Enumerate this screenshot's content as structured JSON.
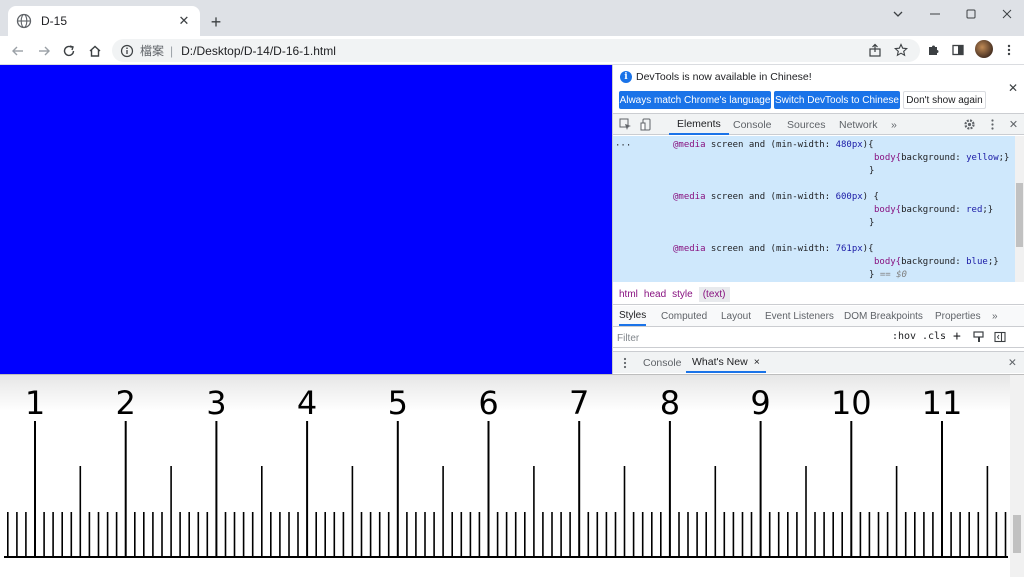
{
  "browser": {
    "tab_title": "D-15",
    "security_label": "檔案",
    "separator": "|",
    "url": "D:/Desktop/D-14/D-16-1.html",
    "page_background": "#0000ff"
  },
  "devtools": {
    "banner_message": "DevTools is now available in Chinese!",
    "banner_buttons": [
      "Always match Chrome's language",
      "Switch DevTools to Chinese",
      "Don't show again"
    ],
    "main_tabs": [
      "Elements",
      "Console",
      "Sources",
      "Network"
    ],
    "active_main_tab": "Elements",
    "code": {
      "m1_at": "@media",
      "m1_rest": " screen and (min-width: ",
      "m1_val": "480px",
      "m1_end": "){",
      "m1_body_sel": "body{",
      "m1_prop": "background",
      "m1_colon": ": ",
      "m1_color": "yellow",
      "m1_close": ";}",
      "m1_brace": "}",
      "m2_at": "@media",
      "m2_rest": " screen and (min-width: ",
      "m2_val": "600px",
      "m2_end": ") {",
      "m2_body_sel": "body{",
      "m2_prop": "background",
      "m2_colon": ": ",
      "m2_color": "red",
      "m2_close": ";}",
      "m2_brace": "}",
      "m3_at": "@media",
      "m3_rest": " screen and (min-width: ",
      "m3_val": "761px",
      "m3_end": "){",
      "m3_body_sel": "body{",
      "m3_prop": "background",
      "m3_colon": ": ",
      "m3_color": "blue",
      "m3_close": ";}",
      "m3_brace": "}",
      "m3_eq": " == $0",
      "gutter": "···"
    },
    "breadcrumbs": [
      "html",
      "head",
      "style",
      "(text)"
    ],
    "sub_tabs": [
      "Styles",
      "Computed",
      "Layout",
      "Event Listeners",
      "DOM Breakpoints",
      "Properties"
    ],
    "filter_placeholder": "Filter",
    "filter_hov": ":hov",
    "filter_cls": ".cls",
    "filter_plus": "+",
    "drawer_tabs": [
      "Console",
      "What's New"
    ],
    "drawer_close": "×",
    "more": "»"
  },
  "ruler": {
    "labels": [
      "1",
      "2",
      "3",
      "4",
      "5",
      "6",
      "7",
      "8",
      "9",
      "10",
      "11"
    ],
    "unit_count": 11,
    "subdivisions": 10
  }
}
